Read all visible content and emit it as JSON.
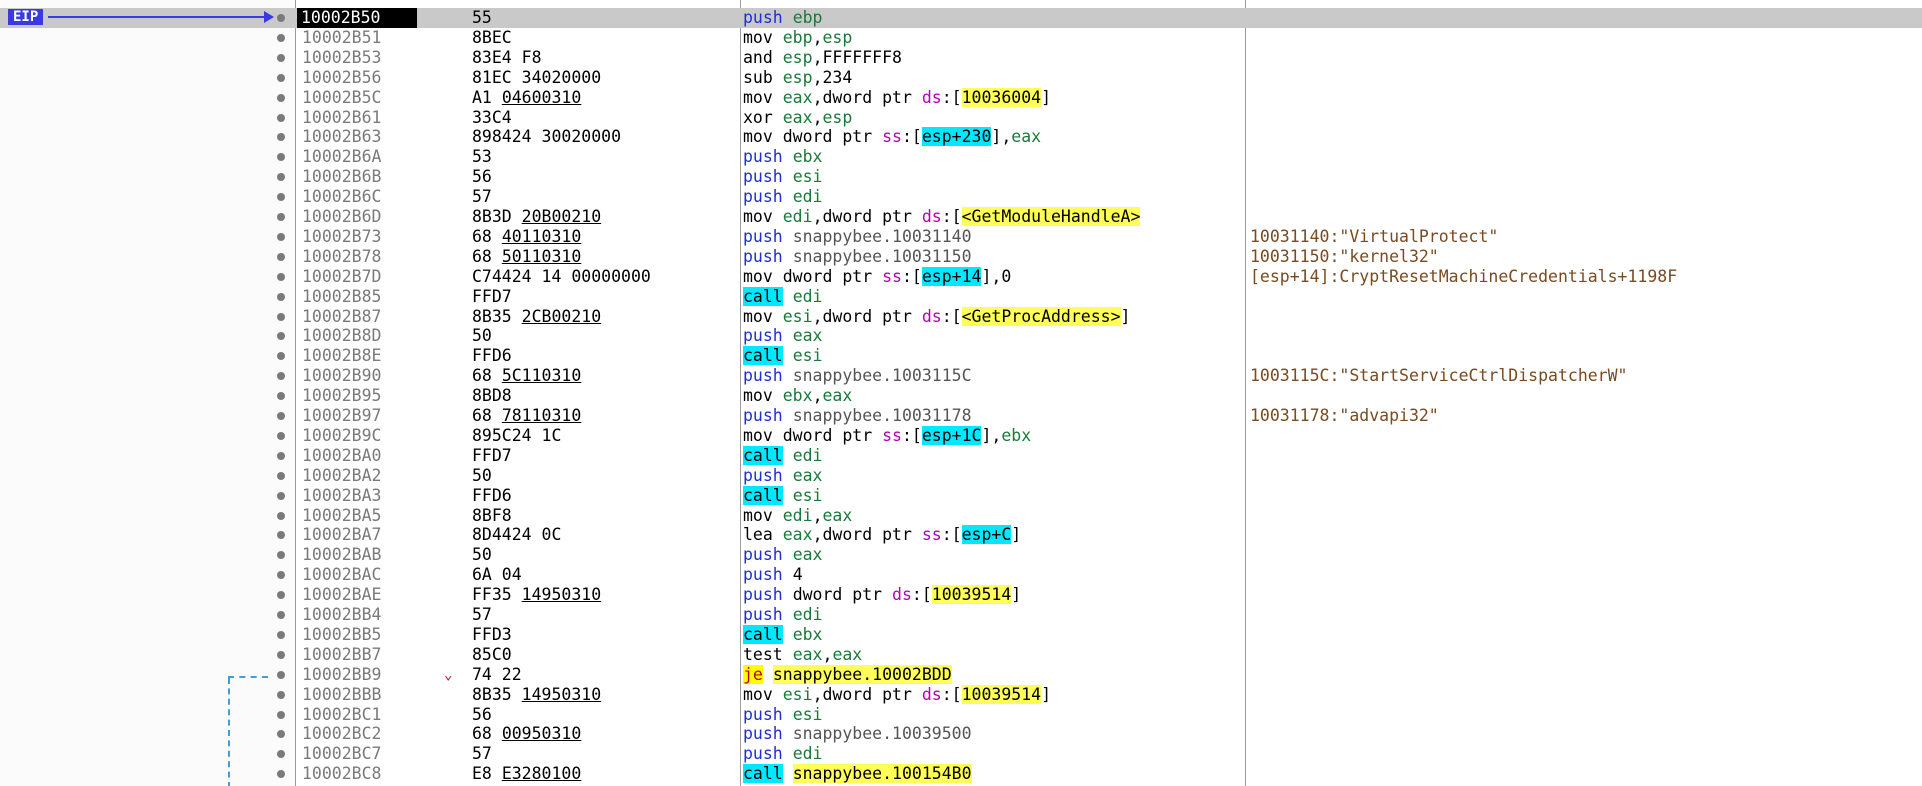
{
  "eip_label": "EIP",
  "rows": [
    {
      "addr": "10002B50",
      "bytes": "55",
      "parts": [
        [
          "push",
          "push"
        ],
        [
          "sp",
          " "
        ],
        [
          "reg",
          "ebp"
        ]
      ],
      "comment": "",
      "current": true
    },
    {
      "addr": "10002B51",
      "bytes": "8BEC",
      "parts": [
        [
          "op",
          "mov"
        ],
        [
          "sp",
          " "
        ],
        [
          "reg",
          "ebp"
        ],
        [
          "op",
          ","
        ],
        [
          "reg",
          "esp"
        ]
      ],
      "comment": ""
    },
    {
      "addr": "10002B53",
      "bytes": "83E4 F8",
      "parts": [
        [
          "op",
          "and"
        ],
        [
          "sp",
          " "
        ],
        [
          "reg",
          "esp"
        ],
        [
          "op",
          ","
        ],
        [
          "num",
          "FFFFFFF8"
        ]
      ],
      "comment": ""
    },
    {
      "addr": "10002B56",
      "bytes": "81EC 34020000",
      "parts": [
        [
          "op",
          "sub"
        ],
        [
          "sp",
          " "
        ],
        [
          "reg",
          "esp"
        ],
        [
          "op",
          ","
        ],
        [
          "num",
          "234"
        ]
      ],
      "comment": ""
    },
    {
      "addr": "10002B5C",
      "bytes": "A1 04600310",
      "bytes_u": "04600310",
      "parts": [
        [
          "op",
          "mov"
        ],
        [
          "sp",
          " "
        ],
        [
          "reg",
          "eax"
        ],
        [
          "op",
          ","
        ],
        [
          "op",
          "dword ptr "
        ],
        [
          "seg",
          "ds"
        ],
        [
          "op",
          ":["
        ],
        [
          "lbl",
          "10036004"
        ],
        [
          "op",
          "]"
        ]
      ],
      "comment": ""
    },
    {
      "addr": "10002B61",
      "bytes": "33C4",
      "parts": [
        [
          "op",
          "xor"
        ],
        [
          "sp",
          " "
        ],
        [
          "reg",
          "eax"
        ],
        [
          "op",
          ","
        ],
        [
          "reg",
          "esp"
        ]
      ],
      "comment": ""
    },
    {
      "addr": "10002B63",
      "bytes": "898424 30020000",
      "parts": [
        [
          "op",
          "mov"
        ],
        [
          "sp",
          " "
        ],
        [
          "op",
          "dword ptr "
        ],
        [
          "seg",
          "ss"
        ],
        [
          "op",
          ":["
        ],
        [
          "bhi",
          "esp+230"
        ],
        [
          "op",
          "],"
        ],
        [
          "reg",
          "eax"
        ]
      ],
      "comment": ""
    },
    {
      "addr": "10002B6A",
      "bytes": "53",
      "parts": [
        [
          "push",
          "push"
        ],
        [
          "sp",
          " "
        ],
        [
          "reg",
          "ebx"
        ]
      ],
      "comment": ""
    },
    {
      "addr": "10002B6B",
      "bytes": "56",
      "parts": [
        [
          "push",
          "push"
        ],
        [
          "sp",
          " "
        ],
        [
          "reg",
          "esi"
        ]
      ],
      "comment": ""
    },
    {
      "addr": "10002B6C",
      "bytes": "57",
      "parts": [
        [
          "push",
          "push"
        ],
        [
          "sp",
          " "
        ],
        [
          "reg",
          "edi"
        ]
      ],
      "comment": ""
    },
    {
      "addr": "10002B6D",
      "bytes": "8B3D 20B00210",
      "bytes_u": "20B00210",
      "parts": [
        [
          "op",
          "mov"
        ],
        [
          "sp",
          " "
        ],
        [
          "reg",
          "edi"
        ],
        [
          "op",
          ","
        ],
        [
          "op",
          "dword ptr "
        ],
        [
          "seg",
          "ds"
        ],
        [
          "op",
          ":["
        ],
        [
          "lbl",
          "<GetModuleHandleA>"
        ]
      ],
      "comment": ""
    },
    {
      "addr": "10002B73",
      "bytes": "68 40110310",
      "bytes_u": "40110310",
      "parts": [
        [
          "push",
          "push"
        ],
        [
          "sp",
          " "
        ],
        [
          "addr",
          "snappybee.10031140"
        ]
      ],
      "comment": "10031140:\"VirtualProtect\""
    },
    {
      "addr": "10002B78",
      "bytes": "68 50110310",
      "bytes_u": "50110310",
      "parts": [
        [
          "push",
          "push"
        ],
        [
          "sp",
          " "
        ],
        [
          "addr",
          "snappybee.10031150"
        ]
      ],
      "comment": "10031150:\"kernel32\""
    },
    {
      "addr": "10002B7D",
      "bytes": "C74424 14 00000000",
      "parts": [
        [
          "op",
          "mov"
        ],
        [
          "sp",
          " "
        ],
        [
          "op",
          "dword ptr "
        ],
        [
          "seg",
          "ss"
        ],
        [
          "op",
          ":["
        ],
        [
          "bhi",
          "esp+14"
        ],
        [
          "op",
          "],"
        ],
        [
          "num",
          "0"
        ]
      ],
      "comment": "[esp+14]:CryptResetMachineCredentials+1198F"
    },
    {
      "addr": "10002B85",
      "bytes": "FFD7",
      "parts": [
        [
          "call",
          "call"
        ],
        [
          "sp",
          " "
        ],
        [
          "reg",
          "edi"
        ]
      ],
      "comment": ""
    },
    {
      "addr": "10002B87",
      "bytes": "8B35 2CB00210",
      "bytes_u": "2CB00210",
      "parts": [
        [
          "op",
          "mov"
        ],
        [
          "sp",
          " "
        ],
        [
          "reg",
          "esi"
        ],
        [
          "op",
          ","
        ],
        [
          "op",
          "dword ptr "
        ],
        [
          "seg",
          "ds"
        ],
        [
          "op",
          ":["
        ],
        [
          "lbl",
          "<GetProcAddress>"
        ],
        [
          "op",
          "]"
        ]
      ],
      "comment": ""
    },
    {
      "addr": "10002B8D",
      "bytes": "50",
      "parts": [
        [
          "push",
          "push"
        ],
        [
          "sp",
          " "
        ],
        [
          "reg",
          "eax"
        ]
      ],
      "comment": ""
    },
    {
      "addr": "10002B8E",
      "bytes": "FFD6",
      "parts": [
        [
          "call",
          "call"
        ],
        [
          "sp",
          " "
        ],
        [
          "reg",
          "esi"
        ]
      ],
      "comment": ""
    },
    {
      "addr": "10002B90",
      "bytes": "68 5C110310",
      "bytes_u": "5C110310",
      "parts": [
        [
          "push",
          "push"
        ],
        [
          "sp",
          " "
        ],
        [
          "addr",
          "snappybee.1003115C"
        ]
      ],
      "comment": "1003115C:\"StartServiceCtrlDispatcherW\""
    },
    {
      "addr": "10002B95",
      "bytes": "8BD8",
      "parts": [
        [
          "op",
          "mov"
        ],
        [
          "sp",
          " "
        ],
        [
          "reg",
          "ebx"
        ],
        [
          "op",
          ","
        ],
        [
          "reg",
          "eax"
        ]
      ],
      "comment": ""
    },
    {
      "addr": "10002B97",
      "bytes": "68 78110310",
      "bytes_u": "78110310",
      "parts": [
        [
          "push",
          "push"
        ],
        [
          "sp",
          " "
        ],
        [
          "addr",
          "snappybee.10031178"
        ]
      ],
      "comment": "10031178:\"advapi32\""
    },
    {
      "addr": "10002B9C",
      "bytes": "895C24 1C",
      "parts": [
        [
          "op",
          "mov"
        ],
        [
          "sp",
          " "
        ],
        [
          "op",
          "dword ptr "
        ],
        [
          "seg",
          "ss"
        ],
        [
          "op",
          ":["
        ],
        [
          "bhi",
          "esp+1C"
        ],
        [
          "op",
          "],"
        ],
        [
          "reg",
          "ebx"
        ]
      ],
      "comment": ""
    },
    {
      "addr": "10002BA0",
      "bytes": "FFD7",
      "parts": [
        [
          "call",
          "call"
        ],
        [
          "sp",
          " "
        ],
        [
          "reg",
          "edi"
        ]
      ],
      "comment": ""
    },
    {
      "addr": "10002BA2",
      "bytes": "50",
      "parts": [
        [
          "push",
          "push"
        ],
        [
          "sp",
          " "
        ],
        [
          "reg",
          "eax"
        ]
      ],
      "comment": ""
    },
    {
      "addr": "10002BA3",
      "bytes": "FFD6",
      "parts": [
        [
          "call",
          "call"
        ],
        [
          "sp",
          " "
        ],
        [
          "reg",
          "esi"
        ]
      ],
      "comment": ""
    },
    {
      "addr": "10002BA5",
      "bytes": "8BF8",
      "parts": [
        [
          "op",
          "mov"
        ],
        [
          "sp",
          " "
        ],
        [
          "reg",
          "edi"
        ],
        [
          "op",
          ","
        ],
        [
          "reg",
          "eax"
        ]
      ],
      "comment": ""
    },
    {
      "addr": "10002BA7",
      "bytes": "8D4424 0C",
      "parts": [
        [
          "op",
          "lea"
        ],
        [
          "sp",
          " "
        ],
        [
          "reg",
          "eax"
        ],
        [
          "op",
          ","
        ],
        [
          "op",
          "dword ptr "
        ],
        [
          "seg",
          "ss"
        ],
        [
          "op",
          ":["
        ],
        [
          "bhi",
          "esp+C"
        ],
        [
          "op",
          "]"
        ]
      ],
      "comment": ""
    },
    {
      "addr": "10002BAB",
      "bytes": "50",
      "parts": [
        [
          "push",
          "push"
        ],
        [
          "sp",
          " "
        ],
        [
          "reg",
          "eax"
        ]
      ],
      "comment": ""
    },
    {
      "addr": "10002BAC",
      "bytes": "6A 04",
      "parts": [
        [
          "push",
          "push"
        ],
        [
          "sp",
          " "
        ],
        [
          "num",
          "4"
        ]
      ],
      "comment": ""
    },
    {
      "addr": "10002BAE",
      "bytes": "FF35 14950310",
      "bytes_u": "14950310",
      "parts": [
        [
          "push",
          "push"
        ],
        [
          "sp",
          " "
        ],
        [
          "op",
          "dword ptr "
        ],
        [
          "seg",
          "ds"
        ],
        [
          "op",
          ":["
        ],
        [
          "lbl",
          "10039514"
        ],
        [
          "op",
          "]"
        ]
      ],
      "comment": ""
    },
    {
      "addr": "10002BB4",
      "bytes": "57",
      "parts": [
        [
          "push",
          "push"
        ],
        [
          "sp",
          " "
        ],
        [
          "reg",
          "edi"
        ]
      ],
      "comment": ""
    },
    {
      "addr": "10002BB5",
      "bytes": "FFD3",
      "parts": [
        [
          "call",
          "call"
        ],
        [
          "sp",
          " "
        ],
        [
          "reg",
          "ebx"
        ]
      ],
      "comment": ""
    },
    {
      "addr": "10002BB7",
      "bytes": "85C0",
      "parts": [
        [
          "op",
          "test"
        ],
        [
          "sp",
          " "
        ],
        [
          "reg",
          "eax"
        ],
        [
          "op",
          ","
        ],
        [
          "reg",
          "eax"
        ]
      ],
      "comment": ""
    },
    {
      "addr": "10002BB9",
      "bytes": "74 22",
      "parts": [
        [
          "je",
          "je"
        ],
        [
          "sp",
          " "
        ],
        [
          "lbl",
          "snappybee.10002BDD"
        ]
      ],
      "comment": "",
      "jump": true
    },
    {
      "addr": "10002BBB",
      "bytes": "8B35 14950310",
      "bytes_u": "14950310",
      "parts": [
        [
          "op",
          "mov"
        ],
        [
          "sp",
          " "
        ],
        [
          "reg",
          "esi"
        ],
        [
          "op",
          ","
        ],
        [
          "op",
          "dword ptr "
        ],
        [
          "seg",
          "ds"
        ],
        [
          "op",
          ":["
        ],
        [
          "lbl",
          "10039514"
        ],
        [
          "op",
          "]"
        ]
      ],
      "comment": ""
    },
    {
      "addr": "10002BC1",
      "bytes": "56",
      "parts": [
        [
          "push",
          "push"
        ],
        [
          "sp",
          " "
        ],
        [
          "reg",
          "esi"
        ]
      ],
      "comment": ""
    },
    {
      "addr": "10002BC2",
      "bytes": "68 00950310",
      "bytes_u": "00950310",
      "parts": [
        [
          "push",
          "push"
        ],
        [
          "sp",
          " "
        ],
        [
          "addr",
          "snappybee.10039500"
        ]
      ],
      "comment": ""
    },
    {
      "addr": "10002BC7",
      "bytes": "57",
      "parts": [
        [
          "push",
          "push"
        ],
        [
          "sp",
          " "
        ],
        [
          "reg",
          "edi"
        ]
      ],
      "comment": ""
    },
    {
      "addr": "10002BC8",
      "bytes": "E8 E3280100",
      "bytes_u": "E3280100",
      "parts": [
        [
          "call",
          "call"
        ],
        [
          "sp",
          " "
        ],
        [
          "lbl",
          "snappybee.100154B0"
        ]
      ],
      "comment": ""
    }
  ],
  "jump_chevron": "⌄"
}
